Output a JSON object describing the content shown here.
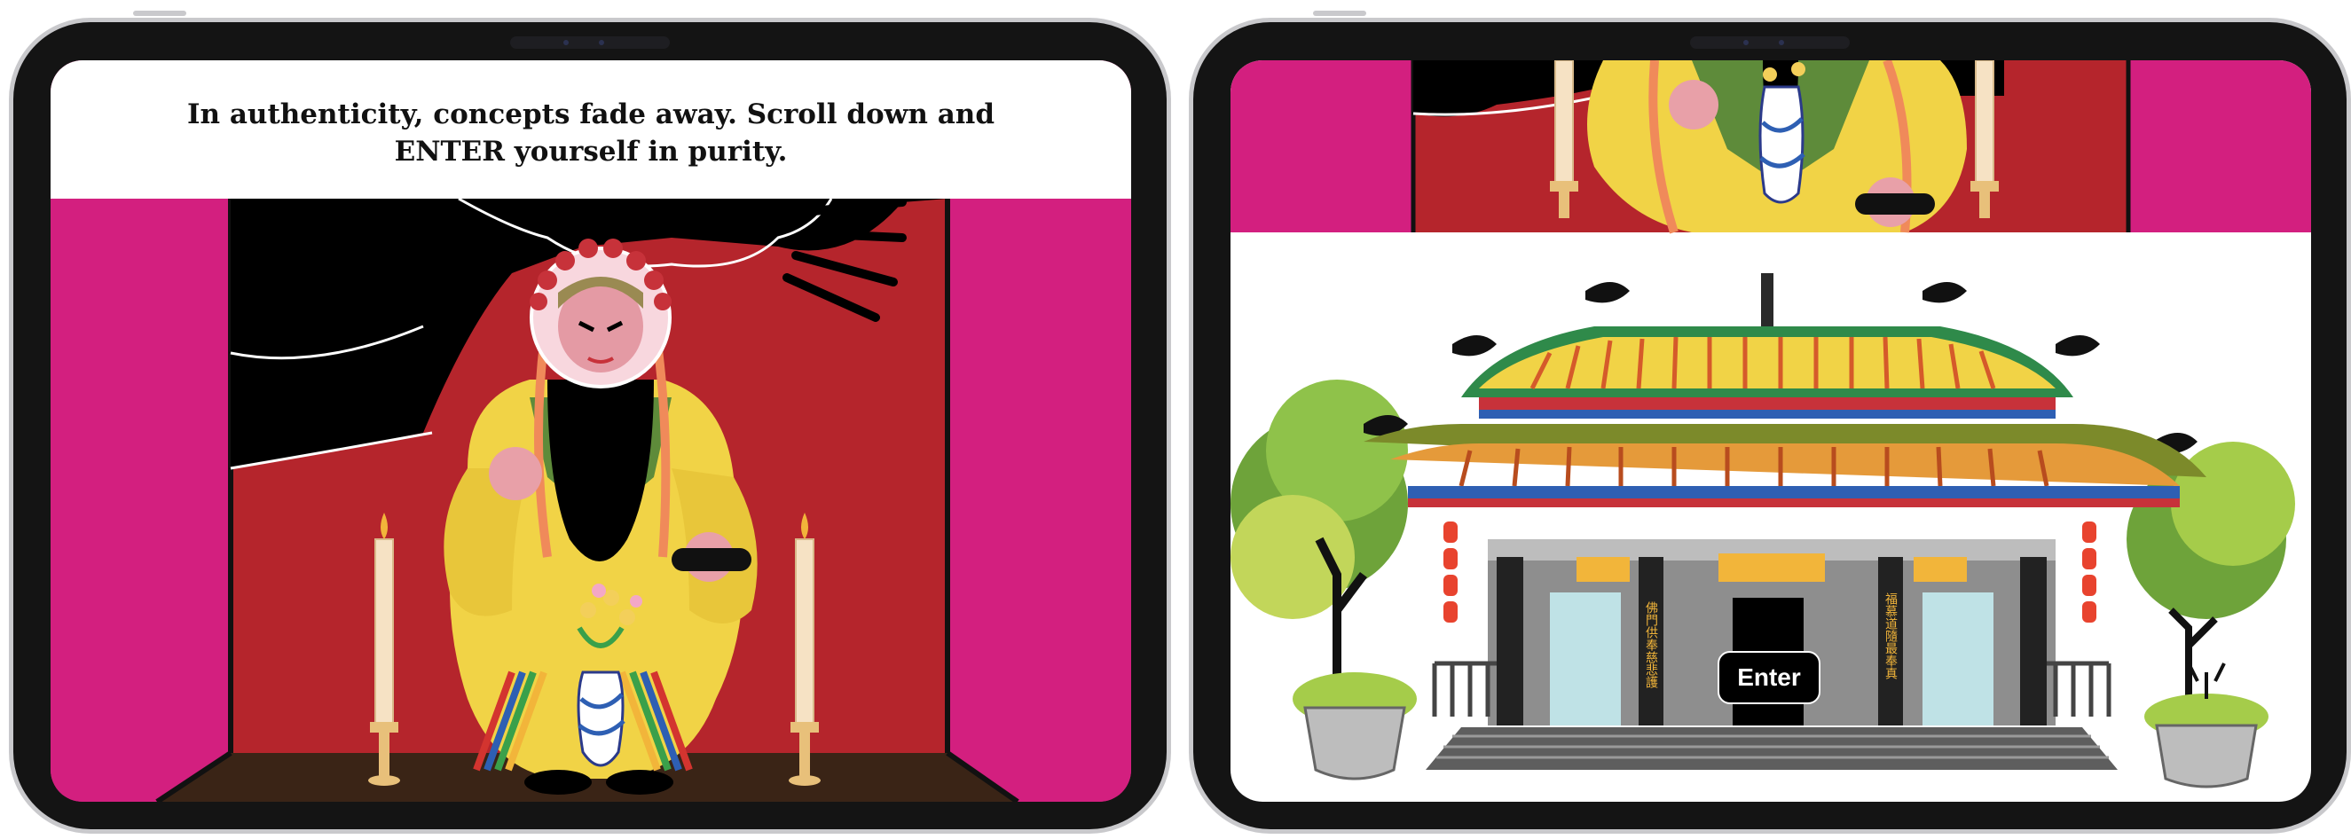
{
  "left_screen": {
    "caption": "In authenticity, concepts fade away. Scroll down and ENTER yourself in purity."
  },
  "right_screen": {
    "enter_label": "Enter",
    "left_couplet": "佛門供奉慈悲護",
    "right_couplet": "福慕道隨最奉真"
  },
  "colors": {
    "magenta": "#d31f7f",
    "red_backdrop": "#b5252c",
    "robe_yellow": "#f1d346",
    "beard": "#000000",
    "floor": "#3a2416"
  },
  "icons": [
    "guan-yu-figure",
    "flower-vase",
    "candle",
    "dragon",
    "temple",
    "tree",
    "planter"
  ]
}
